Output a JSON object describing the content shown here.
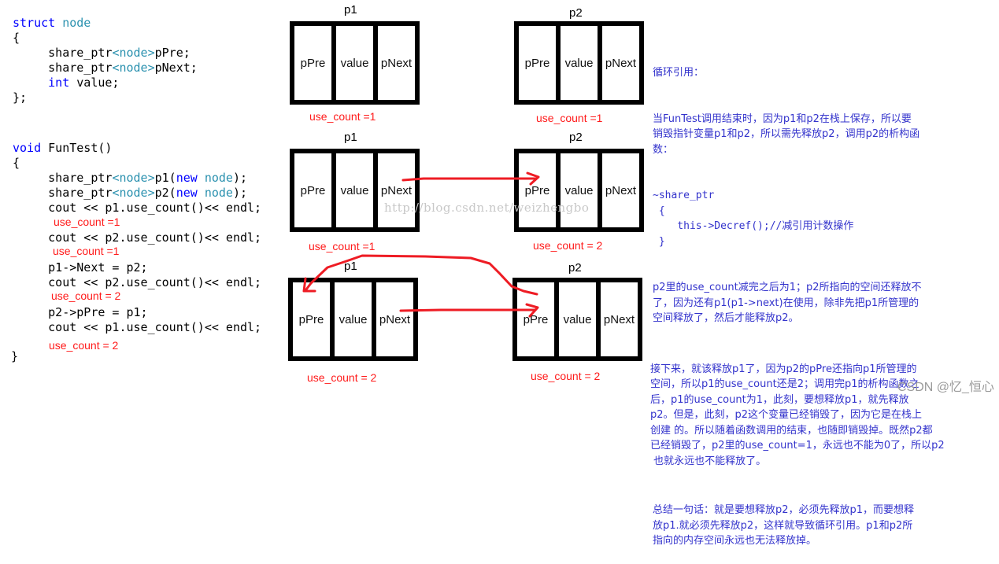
{
  "code": {
    "struct_lines": [
      {
        "parts": [
          {
            "t": "struct",
            "c": "kw"
          },
          {
            "t": " "
          },
          {
            "t": "node",
            "c": "ty"
          }
        ]
      },
      {
        "parts": [
          {
            "t": "{"
          }
        ]
      },
      {
        "parts": [
          {
            "t": "     share_ptr"
          },
          {
            "t": "<node>",
            "c": "ty"
          },
          {
            "t": "pPre;"
          }
        ]
      },
      {
        "parts": [
          {
            "t": "     share_ptr"
          },
          {
            "t": "<node>",
            "c": "ty"
          },
          {
            "t": "pNext;"
          }
        ]
      },
      {
        "parts": [
          {
            "t": "     "
          },
          {
            "t": "int",
            "c": "kw"
          },
          {
            "t": " value;"
          }
        ]
      },
      {
        "parts": [
          {
            "t": "};"
          }
        ]
      }
    ],
    "func_lines": [
      {
        "parts": [
          {
            "t": "void",
            "c": "kw"
          },
          {
            "t": " FunTest()"
          }
        ]
      },
      {
        "parts": [
          {
            "t": "{"
          }
        ]
      },
      {
        "parts": [
          {
            "t": "     share_ptr"
          },
          {
            "t": "<node>",
            "c": "ty"
          },
          {
            "t": "p1("
          },
          {
            "t": "new",
            "c": "kw"
          },
          {
            "t": " "
          },
          {
            "t": "node",
            "c": "ty"
          },
          {
            "t": ");"
          }
        ]
      },
      {
        "parts": [
          {
            "t": "     share_ptr"
          },
          {
            "t": "<node>",
            "c": "ty"
          },
          {
            "t": "p2("
          },
          {
            "t": "new",
            "c": "kw"
          },
          {
            "t": " "
          },
          {
            "t": "node",
            "c": "ty"
          },
          {
            "t": ");"
          }
        ]
      },
      {
        "parts": [
          {
            "t": "     cout << p1.use_count()<< endl;"
          }
        ]
      }
    ],
    "func_lines_2": [
      {
        "parts": [
          {
            "t": "     cout << p2.use_count()<< endl;"
          }
        ]
      }
    ],
    "func_lines_3": [
      {
        "parts": [
          {
            "t": "     p1->Next = p2;"
          }
        ]
      },
      {
        "parts": [
          {
            "t": "     cout << p2.use_count()<< endl;"
          }
        ]
      }
    ],
    "func_lines_4": [
      {
        "parts": [
          {
            "t": "     p2->pPre = p1;"
          }
        ]
      },
      {
        "parts": [
          {
            "t": "     cout << p1.use_count()<< endl;"
          }
        ]
      }
    ],
    "closing_brace": "}",
    "annotations": [
      "use_count =1",
      "use_count =1",
      "use_count = 2",
      "use_count = 2"
    ]
  },
  "diagram": {
    "rows": [
      {
        "p1_label": "p1",
        "p2_label": "p2",
        "p1_count": "use_count =1",
        "p2_count": "use_count =1"
      },
      {
        "p1_label": "p1",
        "p2_label": "p2",
        "p1_count": "use_count =1",
        "p2_count": "use_count = 2"
      },
      {
        "p1_label": "p1",
        "p2_label": "p2",
        "p1_count": "use_count = 2",
        "p2_count": "use_count = 2"
      }
    ],
    "cells": [
      "pPre",
      "value",
      "pNext"
    ],
    "arrow_color": "#ee1c24",
    "watermark": "http://blog.csdn.net/weizhengbo"
  },
  "notes": {
    "title": "循环引用：",
    "p1": [
      "当FunTest调用结束时，因为p1和p2在栈上保存，所以要",
      "销毁指针变量p1和p2，所以需先释放p2，调用p2的析构函",
      "数："
    ],
    "code": [
      "~share_ptr",
      " {",
      "    this->Decref();//减引用计数操作",
      " }"
    ],
    "p2": [
      "p2里的use_count减完之后为1；p2所指向的空间还释放不",
      "了，因为还有p1(p1->next)在使用，除非先把p1所管理的",
      "空间释放了，然后才能释放p2。"
    ],
    "p3": [
      "接下来，就该释放p1了，因为p2的pPre还指向p1所管理的",
      "空间，所以p1的use_count还是2；调用完p1的析构函数之",
      "后，p1的use_count为1，此刻，要想释放p1，就先释放",
      "p2。但是，此刻，p2这个变量已经销毁了，因为它是在栈上",
      "创建 的。所以随着函数调用的结束，也随即销毁掉。既然p2都",
      "已经销毁了，p2里的use_count=1，永远也不能为0了，所以p2",
      " 也就永远也不能释放了。"
    ],
    "p4": [
      "总结一句话：就是要想释放p2，必须先释放p1，而要想释",
      "放p1.就必须先释放p2，这样就导致循环引用。p1和p2所",
      "指向的内存空间永远也无法释放掉。"
    ]
  },
  "watermark_csdn": "CSDN @忆_恒心"
}
